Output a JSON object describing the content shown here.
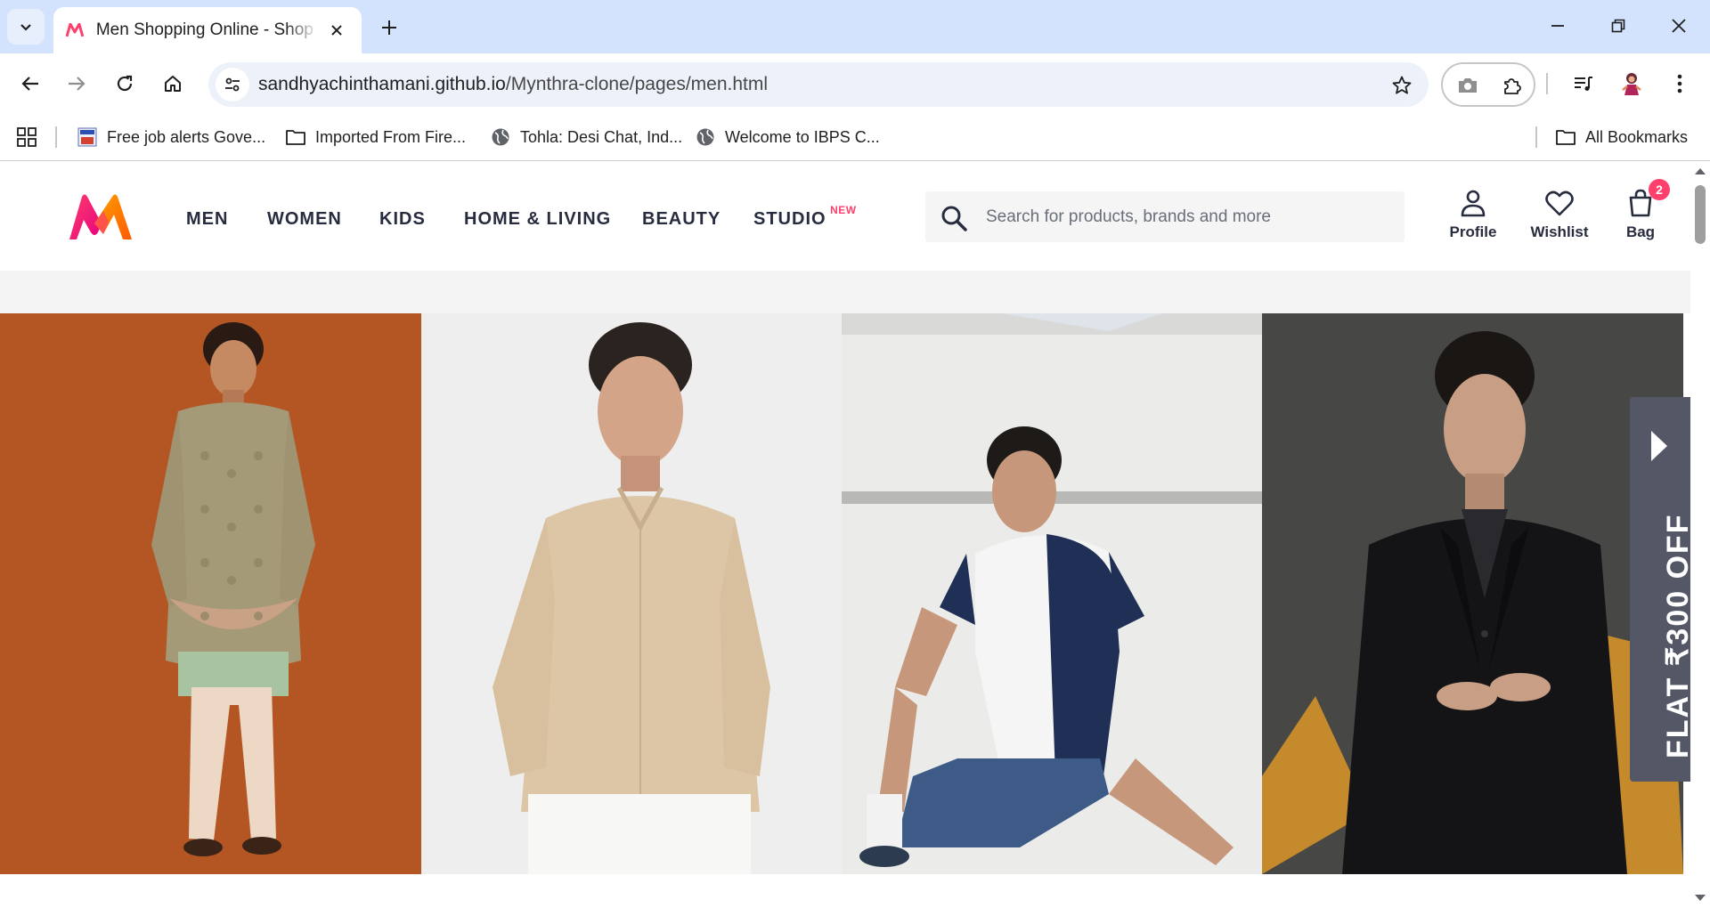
{
  "browser": {
    "tab_title": "Men Shopping Online - Shop for Men",
    "url_domain": "sandhyachinthamani.github.io",
    "url_path": "/Mynthra-clone/pages/men.html",
    "bookmarks": [
      {
        "label": "Free job alerts Gove...",
        "icon": "job-site-favicon"
      },
      {
        "label": "Imported From Fire...",
        "icon": "folder-icon"
      },
      {
        "label": "Tohla: Desi Chat, Ind...",
        "icon": "globe-icon"
      },
      {
        "label": "Welcome to IBPS C...",
        "icon": "globe-icon"
      }
    ],
    "all_bookmarks": "All Bookmarks"
  },
  "site": {
    "nav": [
      "MEN",
      "WOMEN",
      "KIDS",
      "HOME & LIVING",
      "BEAUTY",
      "STUDIO"
    ],
    "studio_badge": "NEW",
    "search_placeholder": "Search for products, brands and more",
    "actions": {
      "profile": "Profile",
      "wishlist": "Wishlist",
      "bag": "Bag",
      "bag_count": "2"
    },
    "offer_text": "FLAT ₹300 OFF",
    "colors": {
      "brand_pink": "#ff3f6c",
      "text_dark": "#282c3f",
      "offer_bg": "#535766"
    }
  },
  "banner_panels": [
    {
      "name": "model-ethnic-sherwani",
      "bg": "#b85a25"
    },
    {
      "name": "model-beige-shirt",
      "bg": "#ececec"
    },
    {
      "name": "model-sports-tee",
      "bg": "#ececea"
    },
    {
      "name": "model-black-suit",
      "bg": "#4a4a4a"
    }
  ]
}
